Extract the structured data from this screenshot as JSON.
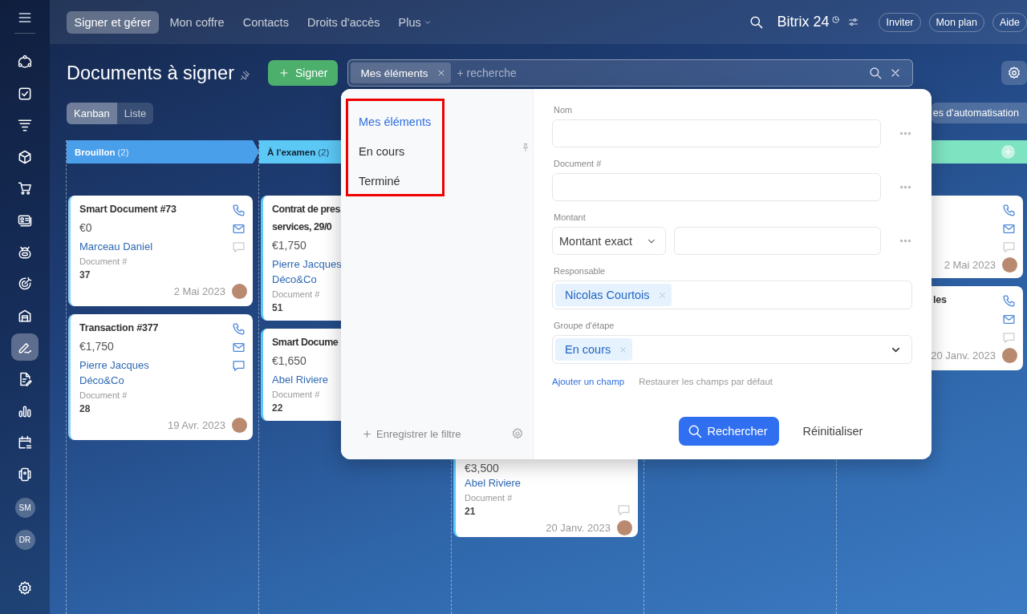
{
  "sidebar": {
    "items": [
      {
        "selected": false
      },
      {
        "selected": false
      },
      {
        "selected": false
      },
      {
        "selected": false
      },
      {
        "selected": false
      },
      {
        "selected": false
      },
      {
        "selected": false
      },
      {
        "selected": false
      },
      {
        "selected": false
      },
      {
        "selected": true
      },
      {
        "selected": false
      },
      {
        "selected": false
      },
      {
        "selected": false
      },
      {
        "selected": false
      }
    ],
    "avatars": [
      "SM",
      "DR"
    ]
  },
  "top_nav": {
    "tabs": [
      {
        "label": "Signer et gérer",
        "selected": true,
        "kind": "tab"
      },
      {
        "label": "Mon coffre",
        "selected": false,
        "kind": "tab"
      },
      {
        "label": "Contacts",
        "selected": false,
        "kind": "tab"
      },
      {
        "label": "Droits d'accès",
        "selected": false,
        "kind": "tab"
      },
      {
        "label": "Plus",
        "selected": false,
        "kind": "menu"
      }
    ],
    "logo": {
      "name": "Bitrix",
      "number": "24"
    },
    "buttons": [
      "Inviter",
      "Mon plan",
      "Aide"
    ]
  },
  "page": {
    "title": "Documents à signer",
    "create_button": "Signer",
    "search": {
      "chip": "Mes éléments",
      "placeholder": "+ recherche"
    },
    "views": [
      {
        "label": "Kanban",
        "selected": true
      },
      {
        "label": "Liste",
        "selected": false
      }
    ],
    "automation_button": "es d'automatisation"
  },
  "kanban": {
    "columns": [
      {
        "header": {
          "title": "Brouillon",
          "count": "(2)",
          "color": "#4a9feb"
        },
        "cards": [
          {
            "kind": "full",
            "title": [
              "Smart Document #73"
            ],
            "amount": "€0",
            "contacts": [
              "Marceau Daniel"
            ],
            "doc_label": "Document #",
            "doc_number": "37",
            "date": "2 Mai 2023",
            "comments": false
          },
          {
            "kind": "full",
            "title": [
              "Transaction #377"
            ],
            "amount": "€1,750",
            "contacts": [
              "Pierre Jacques",
              "Déco&Co"
            ],
            "doc_label": "Document #",
            "doc_number": "28",
            "date": "19 Avr. 2023",
            "comments": true
          }
        ]
      },
      {
        "header": {
          "title": "À l'examen",
          "count": "(2)",
          "color": "#5bc8f6"
        },
        "cards": [
          {
            "kind": "left",
            "title": [
              "Contrat de pres",
              "services, 29/0"
            ],
            "amount": "€1,750",
            "contacts": [
              "Pierre Jacques",
              "Déco&Co"
            ],
            "doc_label": "Document #",
            "doc_number": "51"
          },
          {
            "kind": "left",
            "title": [
              "Smart Docume"
            ],
            "amount": "€1,650",
            "contacts": [
              "Abel Riviere"
            ],
            "doc_label": "Document #",
            "doc_number": "22"
          }
        ]
      },
      {
        "cards": [
          {
            "kind": "bottom",
            "amount": "€3,500",
            "contacts": [
              "Abel Riviere"
            ],
            "doc_label": "Document #",
            "doc_number": "21",
            "date": "20 Janv. 2023",
            "comments": false
          }
        ]
      },
      {},
      {
        "header": {
          "color": "#7de3c1"
        },
        "cards": [
          {
            "kind": "right",
            "date": "2 Mai 2023",
            "comments": false
          },
          {
            "kind": "right",
            "title": [
              "les"
            ],
            "date": "20 Janv. 2023",
            "comments": false
          }
        ]
      }
    ]
  },
  "filter_popup": {
    "presets": [
      {
        "label": "Mes éléments",
        "selected": true
      },
      {
        "label": "En cours",
        "selected": false
      },
      {
        "label": "Terminé",
        "selected": false
      }
    ],
    "save_filter": "Enregistrer le filtre",
    "fields": [
      {
        "kind": "text",
        "label": "Nom"
      },
      {
        "kind": "text",
        "label": "Document #"
      },
      {
        "kind": "amount",
        "label": "Montant",
        "select": "Montant exact"
      },
      {
        "kind": "chips",
        "label": "Responsable",
        "chips": [
          "Nicolas Courtois"
        ]
      },
      {
        "kind": "chips-dropdown",
        "label": "Groupe d'étape",
        "chips": [
          "En cours"
        ]
      }
    ],
    "add_field_link": "Ajouter un champ",
    "restore_link": "Restaurer les champs par défaut",
    "search_button": "Rechercher",
    "reset_button": "Réinitialiser"
  }
}
